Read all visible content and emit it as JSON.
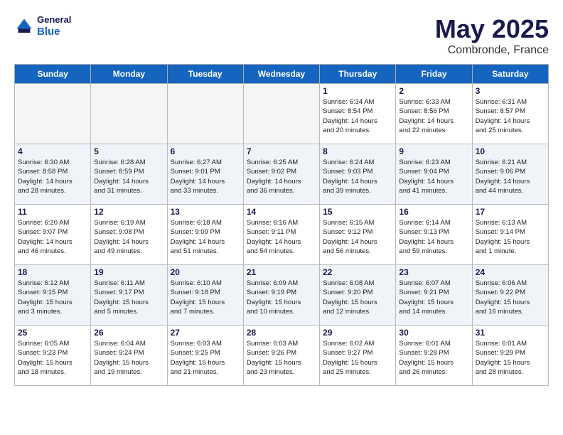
{
  "header": {
    "logo": {
      "general": "General",
      "blue": "Blue"
    },
    "title": "May 2025",
    "location": "Combronde, France"
  },
  "days_of_week": [
    "Sunday",
    "Monday",
    "Tuesday",
    "Wednesday",
    "Thursday",
    "Friday",
    "Saturday"
  ],
  "weeks": [
    [
      {
        "day": "",
        "detail": ""
      },
      {
        "day": "",
        "detail": ""
      },
      {
        "day": "",
        "detail": ""
      },
      {
        "day": "",
        "detail": ""
      },
      {
        "day": "1",
        "detail": "Sunrise: 6:34 AM\nSunset: 8:54 PM\nDaylight: 14 hours\nand 20 minutes."
      },
      {
        "day": "2",
        "detail": "Sunrise: 6:33 AM\nSunset: 8:56 PM\nDaylight: 14 hours\nand 22 minutes."
      },
      {
        "day": "3",
        "detail": "Sunrise: 6:31 AM\nSunset: 8:57 PM\nDaylight: 14 hours\nand 25 minutes."
      }
    ],
    [
      {
        "day": "4",
        "detail": "Sunrise: 6:30 AM\nSunset: 8:58 PM\nDaylight: 14 hours\nand 28 minutes."
      },
      {
        "day": "5",
        "detail": "Sunrise: 6:28 AM\nSunset: 8:59 PM\nDaylight: 14 hours\nand 31 minutes."
      },
      {
        "day": "6",
        "detail": "Sunrise: 6:27 AM\nSunset: 9:01 PM\nDaylight: 14 hours\nand 33 minutes."
      },
      {
        "day": "7",
        "detail": "Sunrise: 6:25 AM\nSunset: 9:02 PM\nDaylight: 14 hours\nand 36 minutes."
      },
      {
        "day": "8",
        "detail": "Sunrise: 6:24 AM\nSunset: 9:03 PM\nDaylight: 14 hours\nand 39 minutes."
      },
      {
        "day": "9",
        "detail": "Sunrise: 6:23 AM\nSunset: 9:04 PM\nDaylight: 14 hours\nand 41 minutes."
      },
      {
        "day": "10",
        "detail": "Sunrise: 6:21 AM\nSunset: 9:06 PM\nDaylight: 14 hours\nand 44 minutes."
      }
    ],
    [
      {
        "day": "11",
        "detail": "Sunrise: 6:20 AM\nSunset: 9:07 PM\nDaylight: 14 hours\nand 46 minutes."
      },
      {
        "day": "12",
        "detail": "Sunrise: 6:19 AM\nSunset: 9:08 PM\nDaylight: 14 hours\nand 49 minutes."
      },
      {
        "day": "13",
        "detail": "Sunrise: 6:18 AM\nSunset: 9:09 PM\nDaylight: 14 hours\nand 51 minutes."
      },
      {
        "day": "14",
        "detail": "Sunrise: 6:16 AM\nSunset: 9:11 PM\nDaylight: 14 hours\nand 54 minutes."
      },
      {
        "day": "15",
        "detail": "Sunrise: 6:15 AM\nSunset: 9:12 PM\nDaylight: 14 hours\nand 56 minutes."
      },
      {
        "day": "16",
        "detail": "Sunrise: 6:14 AM\nSunset: 9:13 PM\nDaylight: 14 hours\nand 59 minutes."
      },
      {
        "day": "17",
        "detail": "Sunrise: 6:13 AM\nSunset: 9:14 PM\nDaylight: 15 hours\nand 1 minute."
      }
    ],
    [
      {
        "day": "18",
        "detail": "Sunrise: 6:12 AM\nSunset: 9:15 PM\nDaylight: 15 hours\nand 3 minutes."
      },
      {
        "day": "19",
        "detail": "Sunrise: 6:11 AM\nSunset: 9:17 PM\nDaylight: 15 hours\nand 5 minutes."
      },
      {
        "day": "20",
        "detail": "Sunrise: 6:10 AM\nSunset: 9:18 PM\nDaylight: 15 hours\nand 7 minutes."
      },
      {
        "day": "21",
        "detail": "Sunrise: 6:09 AM\nSunset: 9:19 PM\nDaylight: 15 hours\nand 10 minutes."
      },
      {
        "day": "22",
        "detail": "Sunrise: 6:08 AM\nSunset: 9:20 PM\nDaylight: 15 hours\nand 12 minutes."
      },
      {
        "day": "23",
        "detail": "Sunrise: 6:07 AM\nSunset: 9:21 PM\nDaylight: 15 hours\nand 14 minutes."
      },
      {
        "day": "24",
        "detail": "Sunrise: 6:06 AM\nSunset: 9:22 PM\nDaylight: 15 hours\nand 16 minutes."
      }
    ],
    [
      {
        "day": "25",
        "detail": "Sunrise: 6:05 AM\nSunset: 9:23 PM\nDaylight: 15 hours\nand 18 minutes."
      },
      {
        "day": "26",
        "detail": "Sunrise: 6:04 AM\nSunset: 9:24 PM\nDaylight: 15 hours\nand 19 minutes."
      },
      {
        "day": "27",
        "detail": "Sunrise: 6:03 AM\nSunset: 9:25 PM\nDaylight: 15 hours\nand 21 minutes."
      },
      {
        "day": "28",
        "detail": "Sunrise: 6:03 AM\nSunset: 9:26 PM\nDaylight: 15 hours\nand 23 minutes."
      },
      {
        "day": "29",
        "detail": "Sunrise: 6:02 AM\nSunset: 9:27 PM\nDaylight: 15 hours\nand 25 minutes."
      },
      {
        "day": "30",
        "detail": "Sunrise: 6:01 AM\nSunset: 9:28 PM\nDaylight: 15 hours\nand 26 minutes."
      },
      {
        "day": "31",
        "detail": "Sunrise: 6:01 AM\nSunset: 9:29 PM\nDaylight: 15 hours\nand 28 minutes."
      }
    ]
  ]
}
